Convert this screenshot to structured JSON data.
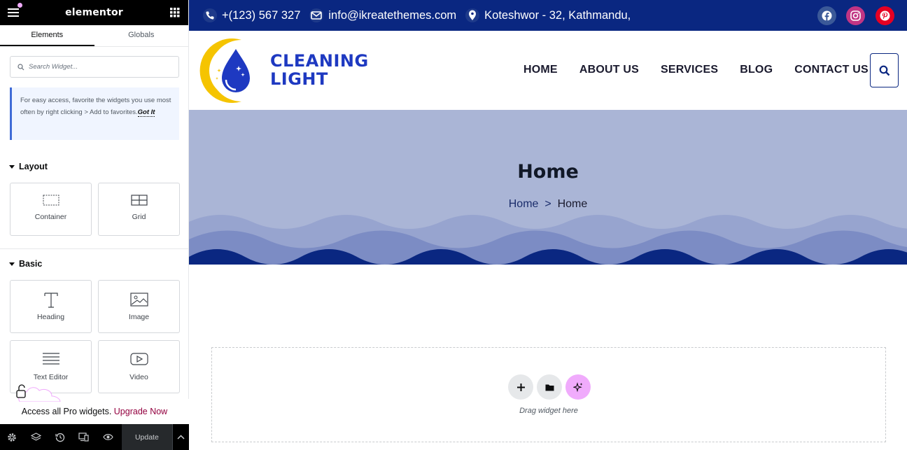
{
  "panel": {
    "brand": "elementor",
    "tabs": [
      "Elements",
      "Globals"
    ],
    "search_placeholder": "Search Widget...",
    "notice_text": "For easy access, favorite the widgets you use most often by right clicking > Add to favorites.",
    "notice_link": "Got It",
    "categories": {
      "layout": {
        "title": "Layout",
        "widgets": [
          "Container",
          "Grid"
        ]
      },
      "basic": {
        "title": "Basic",
        "widgets": [
          "Heading",
          "Image",
          "Text Editor",
          "Video"
        ]
      }
    },
    "promo_text": "Access all Pro widgets.",
    "promo_link": "Upgrade Now",
    "update_label": "Update"
  },
  "site": {
    "phone": "+(123) 567 327",
    "email": "info@ikreatethemes.com",
    "address": "Koteshwor - 32, Kathmandu,",
    "logo_line1": "CLEANING",
    "logo_line2": "LIGHT",
    "nav": [
      "HOME",
      "ABOUT US",
      "SERVICES",
      "BLOG",
      "CONTACT US"
    ],
    "hero_title": "Home",
    "breadcrumb_home": "Home",
    "breadcrumb_sep": ">",
    "breadcrumb_current": "Home",
    "drop_hint": "Drag widget here"
  },
  "colors": {
    "topbar": "#0a2781",
    "hero": "#aab5d6",
    "logo_blue": "#1e39c1",
    "logo_yellow": "#f5c400",
    "facebook": "#3b5998",
    "instagram": "#c13584",
    "pinterest": "#e60023",
    "upgrade": "#93003f",
    "ai_button": "#f0abfc"
  }
}
